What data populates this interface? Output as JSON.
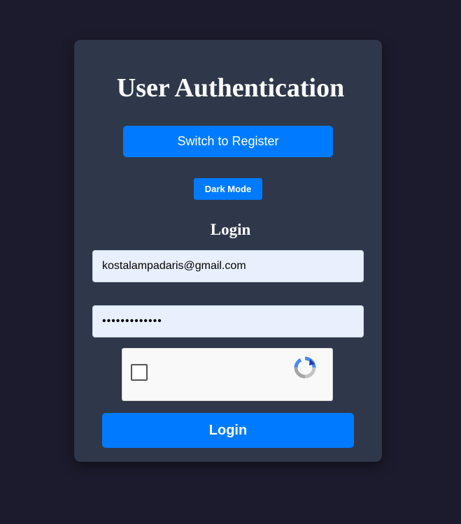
{
  "auth": {
    "title": "User Authentication",
    "switch_label": "Switch to Register",
    "theme_toggle_label": "Dark Mode",
    "form_title": "Login",
    "email_value": "kostalampadaris@gmail.com",
    "password_value": "•••••••••••••",
    "submit_label": "Login"
  },
  "captcha": {
    "checked": false,
    "logo_icon": "recaptcha-logo-icon"
  },
  "colors": {
    "page_background": "#1b1b2d",
    "card_background": "#2e384a",
    "primary": "#007bff",
    "input_background": "#e8f0fe"
  }
}
